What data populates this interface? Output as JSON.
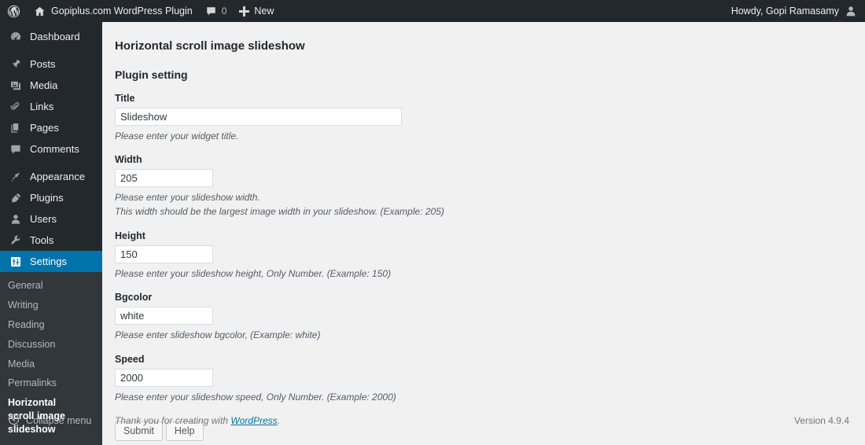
{
  "adminbar": {
    "wp_logo_icon": "wordpress-logo-icon",
    "site_home_icon": "home-icon",
    "site_name": "Gopiplus.com WordPress Plugin",
    "comments_icon": "comment-bubble-icon",
    "comments_count": "0",
    "new_icon": "plus-icon",
    "new_label": "New",
    "howdy": "Howdy, Gopi Ramasamy",
    "avatar_icon": "user-avatar-icon"
  },
  "sidebar": {
    "items": [
      {
        "label": "Dashboard",
        "icon": "dashboard-icon",
        "current": false
      },
      {
        "label": "Posts",
        "icon": "pin-icon",
        "current": false
      },
      {
        "label": "Media",
        "icon": "media-icon",
        "current": false
      },
      {
        "label": "Links",
        "icon": "link-icon",
        "current": false
      },
      {
        "label": "Pages",
        "icon": "pages-icon",
        "current": false
      },
      {
        "label": "Comments",
        "icon": "comment-icon",
        "current": false
      },
      {
        "label": "Appearance",
        "icon": "appearance-brush-icon",
        "current": false
      },
      {
        "label": "Plugins",
        "icon": "plugins-plug-icon",
        "current": false
      },
      {
        "label": "Users",
        "icon": "users-icon",
        "current": false
      },
      {
        "label": "Tools",
        "icon": "tools-wrench-icon",
        "current": false
      },
      {
        "label": "Settings",
        "icon": "settings-sliders-icon",
        "current": true
      }
    ],
    "submenu": [
      {
        "label": "General",
        "current": false
      },
      {
        "label": "Writing",
        "current": false
      },
      {
        "label": "Reading",
        "current": false
      },
      {
        "label": "Discussion",
        "current": false
      },
      {
        "label": "Media",
        "current": false
      },
      {
        "label": "Permalinks",
        "current": false
      },
      {
        "label": "Horizontal scroll image slideshow",
        "current": true
      }
    ],
    "collapse": {
      "label": "Collapse menu",
      "icon": "collapse-arrow-left-icon"
    }
  },
  "main": {
    "page_title": "Horizontal scroll image slideshow",
    "section_title": "Plugin setting",
    "fields": [
      {
        "label": "Title",
        "value": "Slideshow",
        "placeholder": "",
        "hints": [
          "Please enter your widget title."
        ]
      },
      {
        "label": "Width",
        "value": "205",
        "placeholder": "",
        "hints": [
          "Please enter your slideshow width.",
          "This width should be the largest image width in your slideshow. (Example: 205)"
        ]
      },
      {
        "label": "Height",
        "value": "150",
        "placeholder": "",
        "hints": [
          "Please enter your slideshow height, Only Number. (Example: 150)"
        ]
      },
      {
        "label": "Bgcolor",
        "value": "white",
        "placeholder": "",
        "hints": [
          "Please enter slideshow bgcolor, (Example: white)"
        ]
      },
      {
        "label": "Speed",
        "value": "2000",
        "placeholder": "",
        "hints": [
          "Please enter your slideshow speed, Only Number. (Example: 2000)"
        ]
      }
    ],
    "buttons": {
      "submit": "Submit",
      "help": "Help"
    }
  },
  "footer": {
    "thanks_prefix": "Thank you for creating with ",
    "wordpress_link": "WordPress",
    "thanks_suffix": ".",
    "version": "Version 4.9.4"
  },
  "colors": {
    "adminbar_bg": "#23282d",
    "sidebar_bg": "#23282d",
    "submenu_bg": "#32373c",
    "accent_blue": "#0073aa",
    "content_bg": "#f1f1f1",
    "link_blue": "#0073aa"
  }
}
